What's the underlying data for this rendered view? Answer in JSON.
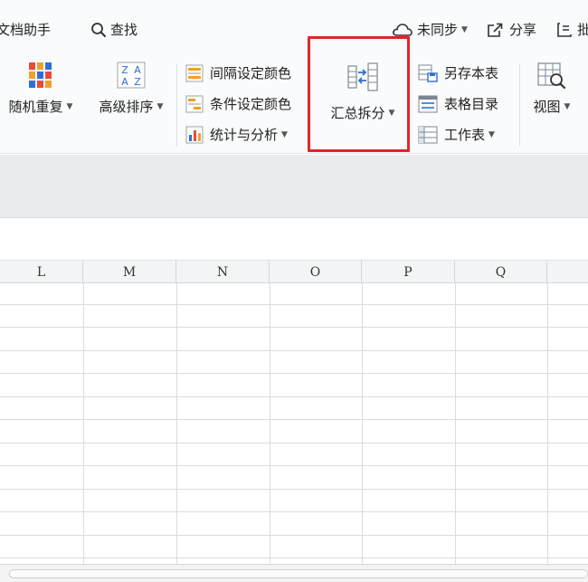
{
  "topbar": {
    "doc_assistant": "文档助手",
    "search": "查找",
    "sync": "未同步",
    "share": "分享",
    "cut_off": "批"
  },
  "ribbon": {
    "random_repeat": "随机重复",
    "advanced_sort": "高级排序",
    "interval_color": "间隔设定颜色",
    "condition_color": "条件设定颜色",
    "stats_analysis": "统计与分析",
    "summary_split": "汇总拆分",
    "save_sheet_as": "另存本表",
    "sheet_catalog": "表格目录",
    "worksheet": "工作表",
    "view": "视图",
    "sort_icon_text": [
      "Z",
      "A",
      "A",
      "Z"
    ]
  },
  "columns": [
    "L",
    "M",
    "N",
    "O",
    "P",
    "Q"
  ],
  "colors": {
    "highlight": "#e0262a",
    "icon_blue": "#2f6fd6",
    "icon_orange": "#f0a030"
  }
}
